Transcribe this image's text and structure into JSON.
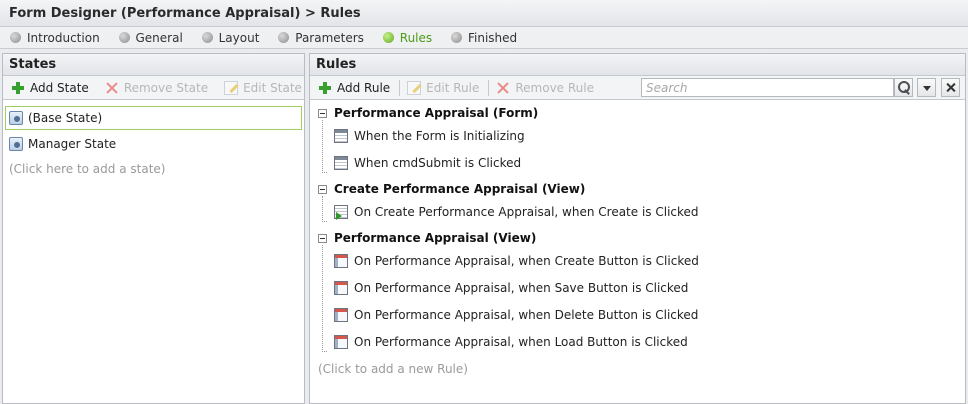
{
  "window": {
    "title": "Form Designer (Performance Appraisal) > Rules"
  },
  "wizard": {
    "steps": [
      {
        "label": "Introduction"
      },
      {
        "label": "General"
      },
      {
        "label": "Layout"
      },
      {
        "label": "Parameters"
      },
      {
        "label": "Rules"
      },
      {
        "label": "Finished"
      }
    ],
    "active_step": "Rules"
  },
  "states_panel": {
    "title": "States",
    "toolbar": {
      "add": "Add State",
      "remove": "Remove State",
      "edit": "Edit State"
    },
    "items": [
      {
        "label": "(Base State)"
      },
      {
        "label": "Manager State"
      }
    ],
    "add_hint": "(Click here to add a state)"
  },
  "rules_panel": {
    "title": "Rules",
    "toolbar": {
      "add": "Add Rule",
      "edit": "Edit Rule",
      "remove": "Remove Rule"
    },
    "search": {
      "placeholder": "Search",
      "value": ""
    },
    "groups": [
      {
        "title": "Performance Appraisal (Form)",
        "rules": [
          {
            "label": "When the Form is Initializing"
          },
          {
            "label": "When cmdSubmit is Clicked"
          }
        ]
      },
      {
        "title": "Create Performance Appraisal (View)",
        "rules": [
          {
            "label": "On Create Performance Appraisal, when Create is Clicked"
          }
        ]
      },
      {
        "title": "Performance Appraisal (View)",
        "rules": [
          {
            "label": "On Performance Appraisal, when Create Button is Clicked"
          },
          {
            "label": "On Performance Appraisal, when Save Button is Clicked"
          },
          {
            "label": "On Performance Appraisal, when Delete Button is Clicked"
          },
          {
            "label": "On Performance Appraisal, when Load Button is Clicked"
          }
        ]
      }
    ],
    "add_hint": "(Click to add a new Rule)"
  },
  "colors": {
    "accent_green": "#4d9b17",
    "selection_border": "#9fcf60"
  },
  "icons": {
    "add": "plus-icon",
    "remove": "x-icon",
    "edit": "edit-icon",
    "state": "state-icon",
    "form_rule": "form-rule-icon",
    "view_rule": "view-rule-icon",
    "create_rule": "create-rule-icon",
    "search": "search-icon",
    "dropdown": "chevron-down-icon",
    "clear": "close-icon"
  }
}
